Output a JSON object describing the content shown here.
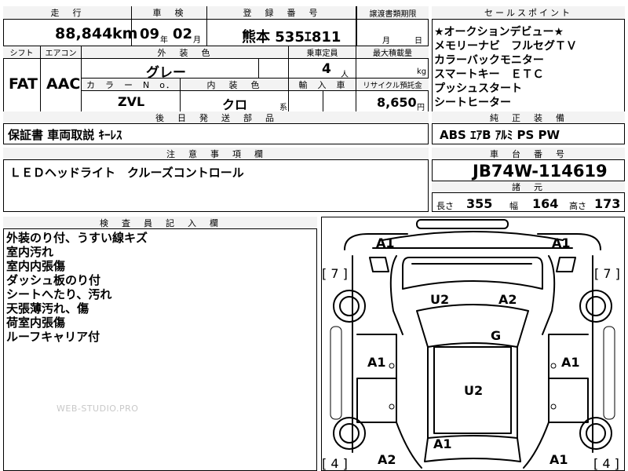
{
  "top_block": {
    "headers": {
      "mileage": "走　行",
      "inspection": "車　検",
      "registration": "登　録　番　号",
      "transfer_deadline": "譲渡書類期限"
    },
    "mileage_value": "88,844",
    "mileage_unit": "km",
    "inspection_year": "09",
    "inspection_year_unit": "年",
    "inspection_month": "02",
    "inspection_month_unit": "月",
    "registration_value": "熊本 535ｴ811",
    "deadline_month": "月",
    "deadline_day": "日"
  },
  "spec_block": {
    "headers": {
      "shift": "シフト",
      "aircon": "エアコン",
      "exterior_color": "外　装　色",
      "capacity": "乗車定員",
      "max_load": "最大積載量",
      "color_no": "カ　ラ　ー　N　o．",
      "interior_color": "内　装　色",
      "import": "輸　入　車",
      "recycle": "リサイクル預託金"
    },
    "shift_value": "FAT",
    "aircon_value": "AAC",
    "exterior_color_value": "グレー",
    "capacity_value": "4",
    "capacity_unit": "人",
    "max_load_unit": "kg",
    "color_no_value": "ZVL",
    "interior_color_value": "クロ",
    "interior_suffix": "系",
    "recycle_value": "8,650",
    "recycle_unit": "円"
  },
  "sales_points": {
    "header": "セールスポイント",
    "lines": [
      "★オークションデビュー★",
      "メモリーナビ　フルセグＴＶ",
      "カラーバックモニター",
      "スマートキー　ＥＴＣ",
      "プッシュスタート",
      "シートヒーター"
    ]
  },
  "later_parts": {
    "header": "後　日　発　送　部　品",
    "text": "保証書 車両取説 ｷｰﾚｽ"
  },
  "genuine_equipment": {
    "header": "純　正　装　備",
    "text": "ABS ｴｱB ｱﾙﾐ PS PW"
  },
  "caution": {
    "header": "注　意　事　項　欄",
    "text": "ＬＥＤヘッドライト　クルーズコントロール"
  },
  "chassis": {
    "header": "車　台　番　号",
    "value": "JB74W-114619",
    "dims_header": "諸　元",
    "length_label": "長さ",
    "length_value": "355",
    "width_label": "幅",
    "width_value": "164",
    "height_label": "高さ",
    "height_value": "173"
  },
  "inspector": {
    "header": "検　査　員　記　入　欄",
    "lines": [
      "外装のり付、うすい線キズ",
      "室内汚れ",
      "室内内張傷",
      "ダッシュ板のり付",
      "シートへたり、汚れ",
      "天張薄汚れ、傷",
      "荷室内張傷",
      "ルーフキャリア付"
    ],
    "watermark": "WEB-STUDIO.PRO"
  },
  "diagram": {
    "marks": {
      "front_left": "A1",
      "front_right": "A1",
      "bracket_top_left": "[ 7 ]",
      "bracket_top_right": "[ 7 ]",
      "bracket_bottom_left": "[ 4 ]",
      "bracket_bottom_right": "[ 4 ]",
      "hood_left": "U2",
      "hood_right": "A2",
      "windshield": "G",
      "left_door": "A1",
      "right_door": "A1",
      "roof": "U2",
      "rear_center": "A1",
      "rear_left": "A2",
      "rear_right": "A1"
    }
  }
}
